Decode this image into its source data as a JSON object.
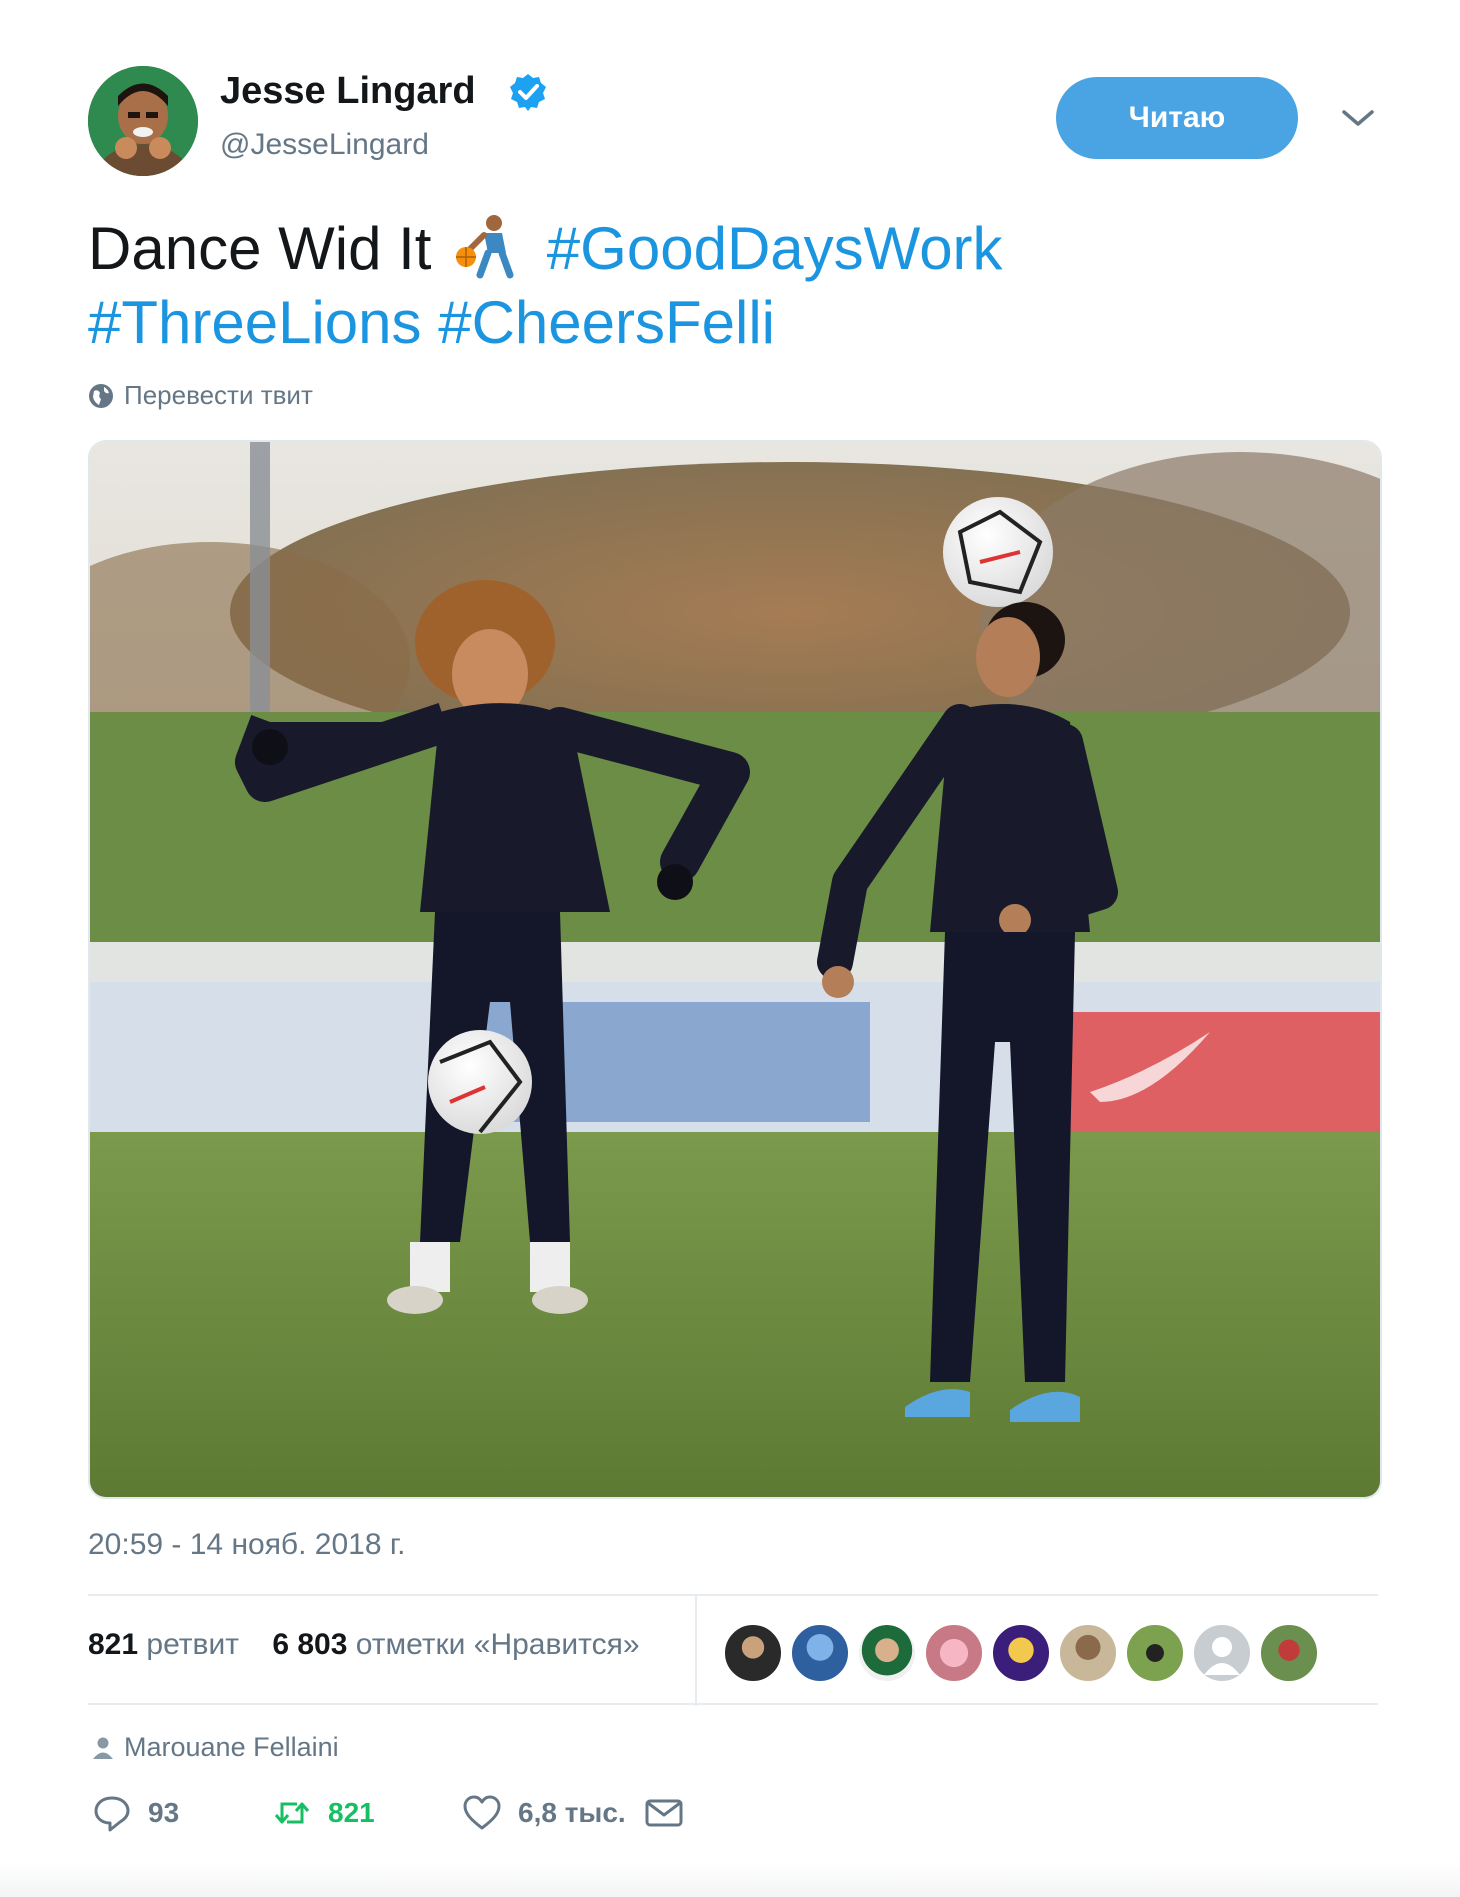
{
  "author": {
    "display_name": "Jesse Lingard",
    "handle": "@JesseLingard",
    "verified": true,
    "avatar_icon": "user-avatar"
  },
  "follow_button": {
    "label": "Читаю"
  },
  "menu": {
    "icon": "chevron-down-icon"
  },
  "tweet": {
    "text_prefix": "Dance Wid It",
    "emoji": "person-bouncing-ball",
    "hashtags": [
      "#GoodDaysWork",
      "#ThreeLions",
      "#CheersFelli"
    ]
  },
  "translate": {
    "icon": "globe-icon",
    "label": "Перевести твит"
  },
  "media": {
    "type": "photo",
    "icon": "photo"
  },
  "timestamp": "20:59 - 14 нояб. 2018 г.",
  "stats": {
    "retweets_count": "821",
    "retweets_label": "ретвит",
    "likes_count": "6 803",
    "likes_label": "отметки «Нравится»"
  },
  "likers_count_shown": 9,
  "tagged": {
    "icon": "person-icon",
    "name": "Marouane Fellaini"
  },
  "actions": {
    "reply": {
      "icon": "reply-icon",
      "count": "93"
    },
    "retweet": {
      "icon": "retweet-icon",
      "count": "821"
    },
    "like": {
      "icon": "heart-icon",
      "count": "6,8 тыс."
    },
    "dm": {
      "icon": "envelope-icon"
    }
  },
  "colors": {
    "accent": "#1b95e0",
    "button": "#4aa3e2",
    "retweet_green": "#17bf63",
    "muted": "#657786"
  }
}
